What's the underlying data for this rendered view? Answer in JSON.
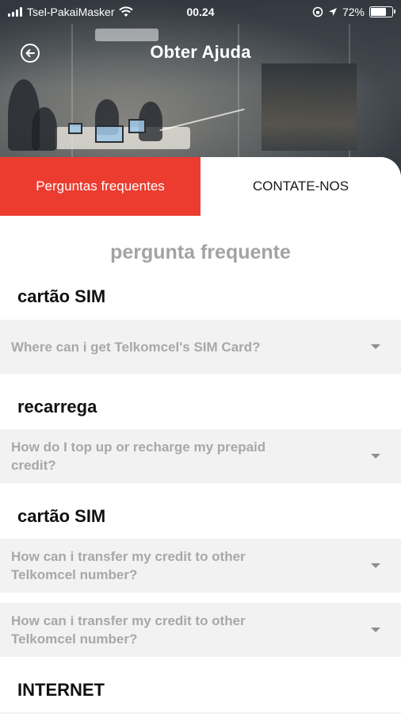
{
  "status_bar": {
    "carrier": "Tsel-PakaiMasker",
    "time": "00.24",
    "battery": "72%",
    "battery_level": 0.72,
    "icons": [
      "signal-icon",
      "wifi-icon",
      "screen-lock-icon",
      "location-arrow-icon",
      "battery-icon"
    ]
  },
  "header": {
    "title": "Obter Ajuda",
    "back_icon": "back-arrow-circle-icon"
  },
  "tabs": [
    {
      "label": "Perguntas frequentes",
      "active": true
    },
    {
      "label": "CONTATE-NOS",
      "active": false
    }
  ],
  "main": {
    "heading": "pergunta frequente",
    "categories": [
      {
        "title": "cartão SIM",
        "questions": [
          "Where can i get Telkomcel's SIM Card?"
        ]
      },
      {
        "title": "recarrega",
        "questions": [
          "How do I top up or recharge my prepaid credit?"
        ]
      },
      {
        "title": "cartão SIM",
        "questions": [
          "How can i transfer my credit to other Telkomcel number?",
          "How can i transfer my credit to other Telkomcel number?"
        ]
      },
      {
        "title": "INTERNET",
        "questions": []
      }
    ]
  },
  "colors": {
    "accent": "#ec3c30",
    "faq_background": "#f2f2f2",
    "muted_text": "#a8a8a8"
  }
}
